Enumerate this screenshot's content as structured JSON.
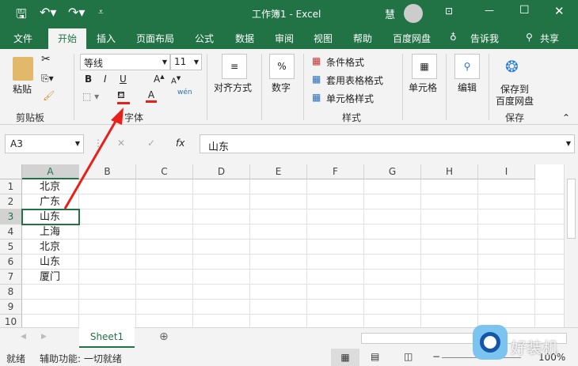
{
  "title": {
    "text": "工作簿1  -  Excel",
    "user": "慧"
  },
  "tabs": [
    "文件",
    "开始",
    "插入",
    "页面布局",
    "公式",
    "数据",
    "审阅",
    "视图",
    "帮助",
    "百度网盘",
    "告诉我",
    "共享"
  ],
  "ribbon": {
    "clipboard": {
      "paste": "粘贴",
      "label": "剪贴板"
    },
    "font": {
      "name": "等线",
      "size": "11",
      "bold": "B",
      "italic": "I",
      "underline": "U",
      "label": "字体",
      "phonetic": "wén"
    },
    "align": {
      "label": "对齐方式"
    },
    "number": {
      "label": "数字",
      "symbol": "%"
    },
    "styles": {
      "cond": "条件格式",
      "table": "套用表格格式",
      "cell": "单元格样式",
      "label": "样式"
    },
    "cells": {
      "label": "单元格"
    },
    "edit": {
      "label": "编辑"
    },
    "save": {
      "label1": "保存到",
      "label2": "百度网盘",
      "group": "保存"
    }
  },
  "formula": {
    "namebox": "A3",
    "fx": "fx",
    "value": "山东"
  },
  "columns": [
    "A",
    "B",
    "C",
    "D",
    "E",
    "F",
    "G",
    "H",
    "I"
  ],
  "rows": [
    "1",
    "2",
    "3",
    "4",
    "5",
    "6",
    "7",
    "8",
    "9",
    "10"
  ],
  "cells_a": [
    "北京",
    "广东",
    "山东",
    "上海",
    "北京",
    "山东",
    "厦门"
  ],
  "sheet": {
    "tab": "Sheet1"
  },
  "status": {
    "ready": "就绪",
    "access": "辅助功能: 一切就绪",
    "zoom": "100%",
    "watermark": "好装机"
  },
  "colors": {
    "accent": "#217346",
    "arrow": "#e8201a"
  }
}
